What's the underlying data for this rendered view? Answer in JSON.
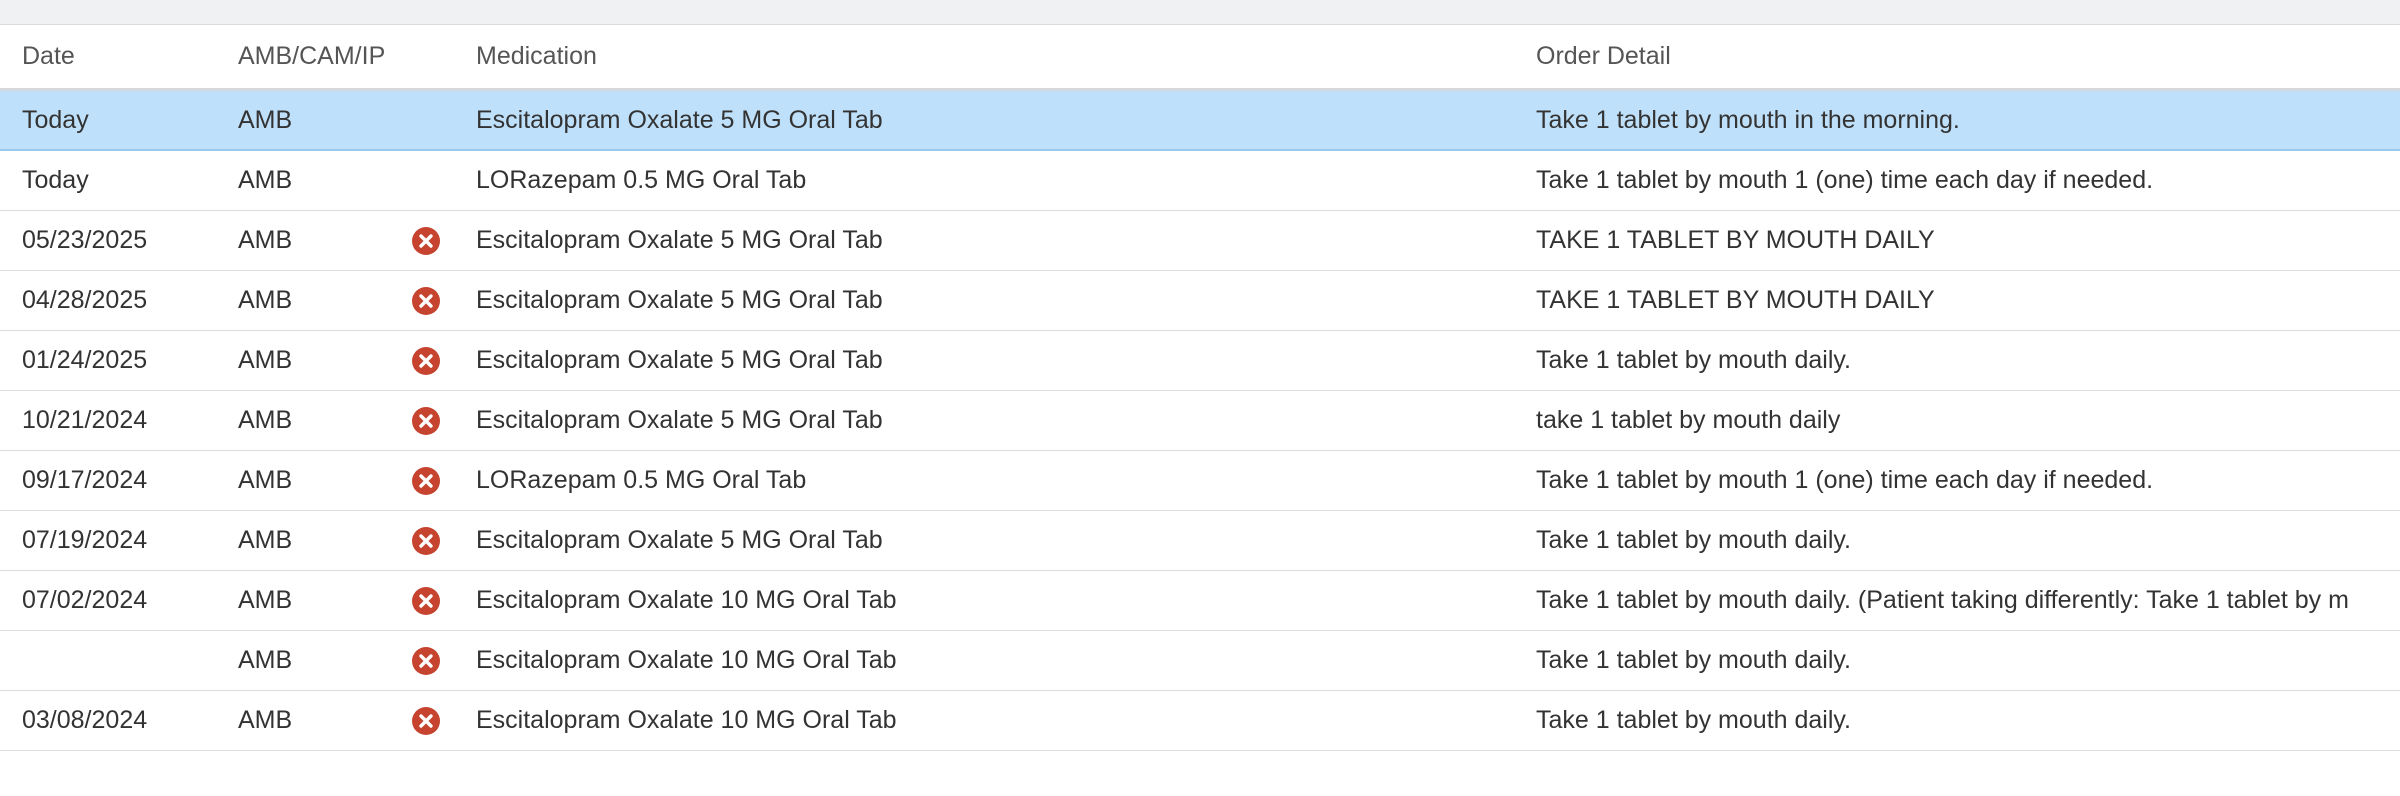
{
  "colors": {
    "selected_row": "#bfe0fa",
    "cancel_icon": "#c5432f",
    "header_text": "#555555"
  },
  "table": {
    "headers": {
      "date": "Date",
      "source": "AMB/CAM/IP",
      "medication": "Medication",
      "order_detail": "Order Detail"
    },
    "rows": [
      {
        "date": "Today",
        "source": "AMB",
        "discontinued_icon": "",
        "medication": "Escitalopram Oxalate 5 MG Oral Tab",
        "order_detail": "Take 1 tablet by mouth in the morning.",
        "selected": true
      },
      {
        "date": "Today",
        "source": "AMB",
        "discontinued_icon": "",
        "medication": "LORazepam 0.5 MG Oral Tab",
        "order_detail": "Take 1 tablet by mouth 1 (one) time each day if needed."
      },
      {
        "date": "05/23/2025",
        "source": "AMB",
        "discontinued_icon": "cancel-icon",
        "medication": "Escitalopram Oxalate 5 MG Oral Tab",
        "order_detail": "TAKE 1 TABLET BY MOUTH DAILY"
      },
      {
        "date": "04/28/2025",
        "source": "AMB",
        "discontinued_icon": "cancel-icon",
        "medication": "Escitalopram Oxalate 5 MG Oral Tab",
        "order_detail": "TAKE 1 TABLET BY MOUTH DAILY"
      },
      {
        "date": "01/24/2025",
        "source": "AMB",
        "discontinued_icon": "cancel-icon",
        "medication": "Escitalopram Oxalate 5 MG Oral Tab",
        "order_detail": "Take 1 tablet by mouth daily."
      },
      {
        "date": "10/21/2024",
        "source": "AMB",
        "discontinued_icon": "cancel-icon",
        "medication": "Escitalopram Oxalate 5 MG Oral Tab",
        "order_detail": "take 1 tablet by mouth daily"
      },
      {
        "date": "09/17/2024",
        "source": "AMB",
        "discontinued_icon": "cancel-icon",
        "medication": "LORazepam 0.5 MG Oral Tab",
        "order_detail": "Take 1 tablet by mouth 1 (one) time each day if needed."
      },
      {
        "date": "07/19/2024",
        "source": "AMB",
        "discontinued_icon": "cancel-icon",
        "medication": "Escitalopram Oxalate 5 MG Oral Tab",
        "order_detail": "Take 1 tablet by mouth daily."
      },
      {
        "date": "07/02/2024",
        "source": "AMB",
        "discontinued_icon": "cancel-icon",
        "medication": "Escitalopram Oxalate 10 MG Oral Tab",
        "order_detail": "Take 1 tablet by mouth daily. (Patient taking differently: Take 1 tablet by m"
      },
      {
        "date": "",
        "source": "AMB",
        "discontinued_icon": "cancel-icon",
        "medication": "Escitalopram Oxalate 10 MG Oral Tab",
        "order_detail": "Take 1 tablet by mouth daily."
      },
      {
        "date": "03/08/2024",
        "source": "AMB",
        "discontinued_icon": "cancel-icon",
        "medication": "Escitalopram Oxalate 10 MG Oral Tab",
        "order_detail": "Take 1 tablet by mouth daily."
      }
    ]
  }
}
